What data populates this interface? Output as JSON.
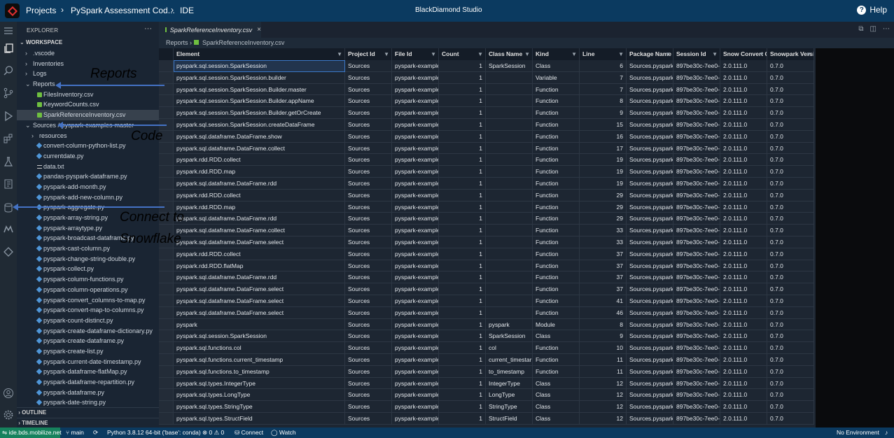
{
  "topbar": {
    "breadcrumb": [
      "Projects",
      "PySpark Assessment Cod...",
      "IDE"
    ],
    "app_title": "BlackDiamond Studio",
    "help_label": "Help"
  },
  "sidebar": {
    "title": "EXPLORER",
    "more": "···",
    "workspace": "WORKSPACE",
    "tree": [
      {
        "label": ".vscode",
        "indent": 1,
        "kind": "folder",
        "open": false
      },
      {
        "label": "Inventories",
        "indent": 1,
        "kind": "folder",
        "open": false
      },
      {
        "label": "Logs",
        "indent": 1,
        "kind": "folder",
        "open": false
      },
      {
        "label": "Reports",
        "indent": 1,
        "kind": "folder",
        "open": true
      },
      {
        "label": "FilesInventory.csv",
        "indent": 2,
        "kind": "csv"
      },
      {
        "label": "KeywordCounts.csv",
        "indent": 2,
        "kind": "csv"
      },
      {
        "label": "SparkReferenceInventory.csv",
        "indent": 2,
        "kind": "csv",
        "selected": true
      },
      {
        "label": "Sources / pyspark-examples-master",
        "indent": 1,
        "kind": "folder",
        "open": true
      },
      {
        "label": "resources",
        "indent": 2,
        "kind": "folder",
        "open": false
      },
      {
        "label": "convert-column-python-list.py",
        "indent": 2,
        "kind": "py"
      },
      {
        "label": "currentdate.py",
        "indent": 2,
        "kind": "py"
      },
      {
        "label": "data.txt",
        "indent": 2,
        "kind": "txt"
      },
      {
        "label": "pandas-pyspark-dataframe.py",
        "indent": 2,
        "kind": "py"
      },
      {
        "label": "pyspark-add-month.py",
        "indent": 2,
        "kind": "py"
      },
      {
        "label": "pyspark-add-new-column.py",
        "indent": 2,
        "kind": "py"
      },
      {
        "label": "pyspark-aggregate.py",
        "indent": 2,
        "kind": "py"
      },
      {
        "label": "pyspark-array-string.py",
        "indent": 2,
        "kind": "py"
      },
      {
        "label": "pyspark-arraytype.py",
        "indent": 2,
        "kind": "py"
      },
      {
        "label": "pyspark-broadcast-dataframe.py",
        "indent": 2,
        "kind": "py"
      },
      {
        "label": "pyspark-cast-column.py",
        "indent": 2,
        "kind": "py"
      },
      {
        "label": "pyspark-change-string-double.py",
        "indent": 2,
        "kind": "py"
      },
      {
        "label": "pyspark-collect.py",
        "indent": 2,
        "kind": "py"
      },
      {
        "label": "pyspark-column-functions.py",
        "indent": 2,
        "kind": "py"
      },
      {
        "label": "pyspark-column-operations.py",
        "indent": 2,
        "kind": "py"
      },
      {
        "label": "pyspark-convert_columns-to-map.py",
        "indent": 2,
        "kind": "py"
      },
      {
        "label": "pyspark-convert-map-to-columns.py",
        "indent": 2,
        "kind": "py"
      },
      {
        "label": "pyspark-count-distinct.py",
        "indent": 2,
        "kind": "py"
      },
      {
        "label": "pyspark-create-dataframe-dictionary.py",
        "indent": 2,
        "kind": "py"
      },
      {
        "label": "pyspark-create-dataframe.py",
        "indent": 2,
        "kind": "py"
      },
      {
        "label": "pyspark-create-list.py",
        "indent": 2,
        "kind": "py"
      },
      {
        "label": "pyspark-current-date-timestamp.py",
        "indent": 2,
        "kind": "py"
      },
      {
        "label": "pyspark-dataframe-flatMap.py",
        "indent": 2,
        "kind": "py"
      },
      {
        "label": "pyspark-dataframe-repartition.py",
        "indent": 2,
        "kind": "py"
      },
      {
        "label": "pyspark-dataframe.py",
        "indent": 2,
        "kind": "py"
      },
      {
        "label": "pyspark-date-string.py",
        "indent": 2,
        "kind": "py"
      }
    ],
    "outline": "OUTLINE",
    "timeline": "TIMELINE"
  },
  "editor": {
    "tab_label": "SparkReferenceInventory.csv",
    "tab_close": "×",
    "breadcrumb": [
      "Reports",
      "SparkReferenceInventory.csv"
    ],
    "columns": [
      "Element",
      "Project Id",
      "File Id",
      "Count",
      "Class Name",
      "Kind",
      "Line",
      "Package Name",
      "Session Id",
      "Snow Convert C",
      "Snowpark Versi"
    ],
    "filter_glyph": "▼",
    "rows": [
      [
        "pyspark.sql.session.SparkSession",
        "Sources",
        "pyspark-example",
        "1",
        "SparkSession",
        "Class",
        "6",
        "Sources.pyspark",
        "897be30c-7ee0-",
        "2.0.111.0",
        "0.7.0"
      ],
      [
        "pyspark.sql.session.SparkSession.builder",
        "Sources",
        "pyspark-example",
        "1",
        "",
        "Variable",
        "7",
        "Sources.pyspark",
        "897be30c-7ee0-",
        "2.0.111.0",
        "0.7.0"
      ],
      [
        "pyspark.sql.session.SparkSession.Builder.master",
        "Sources",
        "pyspark-example",
        "1",
        "",
        "Function",
        "7",
        "Sources.pyspark",
        "897be30c-7ee0-",
        "2.0.111.0",
        "0.7.0"
      ],
      [
        "pyspark.sql.session.SparkSession.Builder.appName",
        "Sources",
        "pyspark-example",
        "1",
        "",
        "Function",
        "8",
        "Sources.pyspark",
        "897be30c-7ee0-",
        "2.0.111.0",
        "0.7.0"
      ],
      [
        "pyspark.sql.session.SparkSession.Builder.getOrCreate",
        "Sources",
        "pyspark-example",
        "1",
        "",
        "Function",
        "9",
        "Sources.pyspark",
        "897be30c-7ee0-",
        "2.0.111.0",
        "0.7.0"
      ],
      [
        "pyspark.sql.session.SparkSession.createDataFrame",
        "Sources",
        "pyspark-example",
        "1",
        "",
        "Function",
        "15",
        "Sources.pyspark",
        "897be30c-7ee0-",
        "2.0.111.0",
        "0.7.0"
      ],
      [
        "pyspark.sql.dataframe.DataFrame.show",
        "Sources",
        "pyspark-example",
        "1",
        "",
        "Function",
        "16",
        "Sources.pyspark",
        "897be30c-7ee0-",
        "2.0.111.0",
        "0.7.0"
      ],
      [
        "pyspark.sql.dataframe.DataFrame.collect",
        "Sources",
        "pyspark-example",
        "1",
        "",
        "Function",
        "17",
        "Sources.pyspark",
        "897be30c-7ee0-",
        "2.0.111.0",
        "0.7.0"
      ],
      [
        "pyspark.rdd.RDD.collect",
        "Sources",
        "pyspark-example",
        "1",
        "",
        "Function",
        "19",
        "Sources.pyspark",
        "897be30c-7ee0-",
        "2.0.111.0",
        "0.7.0"
      ],
      [
        "pyspark.rdd.RDD.map",
        "Sources",
        "pyspark-example",
        "1",
        "",
        "Function",
        "19",
        "Sources.pyspark",
        "897be30c-7ee0-",
        "2.0.111.0",
        "0.7.0"
      ],
      [
        "pyspark.sql.dataframe.DataFrame.rdd",
        "Sources",
        "pyspark-example",
        "1",
        "",
        "Function",
        "19",
        "Sources.pyspark",
        "897be30c-7ee0-",
        "2.0.111.0",
        "0.7.0"
      ],
      [
        "pyspark.rdd.RDD.collect",
        "Sources",
        "pyspark-example",
        "1",
        "",
        "Function",
        "29",
        "Sources.pyspark",
        "897be30c-7ee0-",
        "2.0.111.0",
        "0.7.0"
      ],
      [
        "pyspark.rdd.RDD.map",
        "Sources",
        "pyspark-example",
        "1",
        "",
        "Function",
        "29",
        "Sources.pyspark",
        "897be30c-7ee0-",
        "2.0.111.0",
        "0.7.0"
      ],
      [
        "pyspark.sql.dataframe.DataFrame.rdd",
        "Sources",
        "pyspark-example",
        "1",
        "",
        "Function",
        "29",
        "Sources.pyspark",
        "897be30c-7ee0-",
        "2.0.111.0",
        "0.7.0"
      ],
      [
        "pyspark.sql.dataframe.DataFrame.collect",
        "Sources",
        "pyspark-example",
        "1",
        "",
        "Function",
        "33",
        "Sources.pyspark",
        "897be30c-7ee0-",
        "2.0.111.0",
        "0.7.0"
      ],
      [
        "pyspark.sql.dataframe.DataFrame.select",
        "Sources",
        "pyspark-example",
        "1",
        "",
        "Function",
        "33",
        "Sources.pyspark",
        "897be30c-7ee0-",
        "2.0.111.0",
        "0.7.0"
      ],
      [
        "pyspark.rdd.RDD.collect",
        "Sources",
        "pyspark-example",
        "1",
        "",
        "Function",
        "37",
        "Sources.pyspark",
        "897be30c-7ee0-",
        "2.0.111.0",
        "0.7.0"
      ],
      [
        "pyspark.rdd.RDD.flatMap",
        "Sources",
        "pyspark-example",
        "1",
        "",
        "Function",
        "37",
        "Sources.pyspark",
        "897be30c-7ee0-",
        "2.0.111.0",
        "0.7.0"
      ],
      [
        "pyspark.sql.dataframe.DataFrame.rdd",
        "Sources",
        "pyspark-example",
        "1",
        "",
        "Function",
        "37",
        "Sources.pyspark",
        "897be30c-7ee0-",
        "2.0.111.0",
        "0.7.0"
      ],
      [
        "pyspark.sql.dataframe.DataFrame.select",
        "Sources",
        "pyspark-example",
        "1",
        "",
        "Function",
        "37",
        "Sources.pyspark",
        "897be30c-7ee0-",
        "2.0.111.0",
        "0.7.0"
      ],
      [
        "pyspark.sql.dataframe.DataFrame.select",
        "Sources",
        "pyspark-example",
        "1",
        "",
        "Function",
        "41",
        "Sources.pyspark",
        "897be30c-7ee0-",
        "2.0.111.0",
        "0.7.0"
      ],
      [
        "pyspark.sql.dataframe.DataFrame.select",
        "Sources",
        "pyspark-example",
        "1",
        "",
        "Function",
        "46",
        "Sources.pyspark",
        "897be30c-7ee0-",
        "2.0.111.0",
        "0.7.0"
      ],
      [
        "pyspark",
        "Sources",
        "pyspark-example",
        "1",
        "pyspark",
        "Module",
        "8",
        "Sources.pyspark",
        "897be30c-7ee0-",
        "2.0.111.0",
        "0.7.0"
      ],
      [
        "pyspark.sql.session.SparkSession",
        "Sources",
        "pyspark-example",
        "1",
        "SparkSession",
        "Class",
        "9",
        "Sources.pyspark",
        "897be30c-7ee0-",
        "2.0.111.0",
        "0.7.0"
      ],
      [
        "pyspark.sql.functions.col",
        "Sources",
        "pyspark-example",
        "1",
        "col",
        "Function",
        "10",
        "Sources.pyspark",
        "897be30c-7ee0-",
        "2.0.111.0",
        "0.7.0"
      ],
      [
        "pyspark.sql.functions.current_timestamp",
        "Sources",
        "pyspark-example",
        "1",
        "current_timestar",
        "Function",
        "11",
        "Sources.pyspark",
        "897be30c-7ee0-",
        "2.0.111.0",
        "0.7.0"
      ],
      [
        "pyspark.sql.functions.to_timestamp",
        "Sources",
        "pyspark-example",
        "1",
        "to_timestamp",
        "Function",
        "11",
        "Sources.pyspark",
        "897be30c-7ee0-",
        "2.0.111.0",
        "0.7.0"
      ],
      [
        "pyspark.sql.types.IntegerType",
        "Sources",
        "pyspark-example",
        "1",
        "IntegerType",
        "Class",
        "12",
        "Sources.pyspark",
        "897be30c-7ee0-",
        "2.0.111.0",
        "0.7.0"
      ],
      [
        "pyspark.sql.types.LongType",
        "Sources",
        "pyspark-example",
        "1",
        "LongType",
        "Class",
        "12",
        "Sources.pyspark",
        "897be30c-7ee0-",
        "2.0.111.0",
        "0.7.0"
      ],
      [
        "pyspark.sql.types.StringType",
        "Sources",
        "pyspark-example",
        "1",
        "StringType",
        "Class",
        "12",
        "Sources.pyspark",
        "897be30c-7ee0-",
        "2.0.111.0",
        "0.7.0"
      ],
      [
        "pyspark.sql.types.StructField",
        "Sources",
        "pyspark-example",
        "1",
        "StructField",
        "Class",
        "12",
        "Sources.pyspark",
        "897be30c-7ee0-",
        "2.0.111.0",
        "0.7.0"
      ]
    ]
  },
  "statusbar": {
    "remote": "ide.bds.mobilize.net",
    "branch": "main",
    "python": "Python 3.8.12 64-bit ('base': conda)",
    "problems": "⊗ 0 ⚠ 0",
    "connect": "Connect",
    "watch": "Watch",
    "environment": "No Environment"
  },
  "annotations": {
    "reports": "Reports",
    "code": "Code",
    "connect_line1": "Connect to",
    "connect_line2": "Snowflake"
  },
  "colors": {
    "topbar": "#0b3a60",
    "sidebar": "#1a2533",
    "grid": "#1d2632",
    "annotation_arrow": "#4472c4",
    "remote_badge": "#16825d"
  }
}
